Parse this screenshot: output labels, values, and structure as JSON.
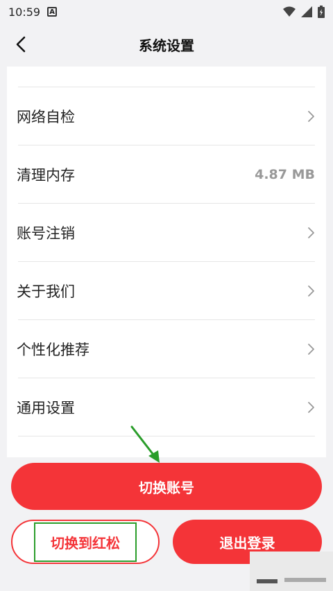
{
  "status_bar": {
    "time": "10:59",
    "notification_letter": "A"
  },
  "header": {
    "title": "系统设置"
  },
  "settings": [
    {
      "label": "网络自检",
      "value": "",
      "has_chevron": true
    },
    {
      "label": "清理内存",
      "value": "4.87 MB",
      "has_chevron": false
    },
    {
      "label": "账号注销",
      "value": "",
      "has_chevron": true
    },
    {
      "label": "关于我们",
      "value": "",
      "has_chevron": true
    },
    {
      "label": "个性化推荐",
      "value": "",
      "has_chevron": true
    },
    {
      "label": "通用设置",
      "value": "",
      "has_chevron": true
    }
  ],
  "buttons": {
    "switch_account": "切换账号",
    "switch_to_hongsong": "切换到红松",
    "logout": "退出登录"
  },
  "colors": {
    "accent": "#f43438",
    "highlight_box": "#2a9d2a",
    "background": "#f2f2f4"
  }
}
